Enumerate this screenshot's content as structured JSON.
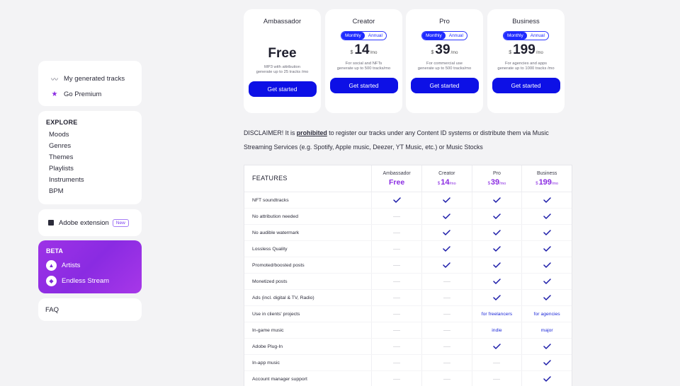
{
  "sidebar": {
    "top": [
      {
        "icon": "waveform-icon",
        "label": "My generated tracks"
      },
      {
        "icon": "star-icon",
        "label": "Go Premium"
      }
    ],
    "explore": {
      "title": "EXPLORE",
      "items": [
        "Moods",
        "Genres",
        "Themes",
        "Playlists",
        "Instruments",
        "BPM"
      ]
    },
    "adobe": {
      "label": "Adobe extension",
      "badge": "New"
    },
    "beta": {
      "title": "BETA",
      "items": [
        {
          "icon": "fire-icon",
          "label": "Artists"
        },
        {
          "icon": "gamepad-icon",
          "label": "Endless Stream"
        }
      ]
    },
    "faq": "FAQ"
  },
  "plans": [
    {
      "name": "Ambassador",
      "price": "Free",
      "desc1": "MP3 with attribution",
      "desc2": "generate up to 25 tracks /mo",
      "cta": "Get started"
    },
    {
      "name": "Creator",
      "toggle_monthly": "Monthly",
      "toggle_annual": "Annual",
      "currency": "$",
      "price": "14",
      "per": "/mo",
      "desc1": "For social and NFTs",
      "desc2": "generate up to 500 tracks/mo",
      "cta": "Get started"
    },
    {
      "name": "Pro",
      "toggle_monthly": "Monthly",
      "toggle_annual": "Annual",
      "currency": "$",
      "price": "39",
      "per": "/mo",
      "desc1": "For commercial use",
      "desc2": "generate up to 500 tracks/mo",
      "cta": "Get started"
    },
    {
      "name": "Business",
      "toggle_monthly": "Monthly",
      "toggle_annual": "Annual",
      "currency": "$",
      "price": "199",
      "per": "/mo",
      "desc1": "For agencies and apps",
      "desc2": "generate up to 1000 tracks /mo",
      "cta": "Get started"
    }
  ],
  "disclaimer": {
    "prefix": "DISCLAIMER! It is ",
    "bold": "prohibited",
    "suffix": " to register our tracks under any Content ID systems or distribute them via Music Streaming Services (e.g. Spotify, Apple music, Deezer, YT Music, etc.) or Music Stocks"
  },
  "table": {
    "header": "FEATURES",
    "columns": [
      {
        "name": "Ambassador",
        "price": "Free"
      },
      {
        "name": "Creator",
        "currency": "$",
        "price": "14",
        "per": "/mo"
      },
      {
        "name": "Pro",
        "currency": "$",
        "price": "39",
        "per": "/mo"
      },
      {
        "name": "Business",
        "currency": "$",
        "price": "199",
        "per": "/mo"
      }
    ],
    "rows": [
      {
        "feature": "NFT soundtracks",
        "cells": [
          "check",
          "check",
          "check",
          "check"
        ]
      },
      {
        "feature": "No attribution needed",
        "cells": [
          "dash",
          "check",
          "check",
          "check"
        ]
      },
      {
        "feature": "No audible watermark",
        "cells": [
          "dash",
          "check",
          "check",
          "check"
        ]
      },
      {
        "feature": "Lossless Quality",
        "cells": [
          "dash",
          "check",
          "check",
          "check"
        ]
      },
      {
        "feature": "Promoted/boosted posts",
        "cells": [
          "dash",
          "check",
          "check",
          "check"
        ]
      },
      {
        "feature": "Monetized posts",
        "cells": [
          "dash",
          "dash",
          "check",
          "check"
        ]
      },
      {
        "feature": "Ads (incl. digital & TV, Radio)",
        "cells": [
          "dash",
          "dash",
          "check",
          "check"
        ]
      },
      {
        "feature": "Use in clients' projects",
        "cells": [
          "dash",
          "dash",
          "for freelancers",
          "for agencies"
        ]
      },
      {
        "feature": "In-game music",
        "cells": [
          "dash",
          "dash",
          "indie",
          "major"
        ]
      },
      {
        "feature": "Adobe Plug-In",
        "cells": [
          "dash",
          "dash",
          "check",
          "check"
        ]
      },
      {
        "feature": "In-app music",
        "cells": [
          "dash",
          "dash",
          "dash",
          "check"
        ]
      },
      {
        "feature": "Account manager support",
        "cells": [
          "dash",
          "dash",
          "dash",
          "check"
        ]
      }
    ]
  },
  "colors": {
    "accent": "#0d10e6",
    "beta": "#8a2be2",
    "price_highlight": "#8a2be2"
  }
}
